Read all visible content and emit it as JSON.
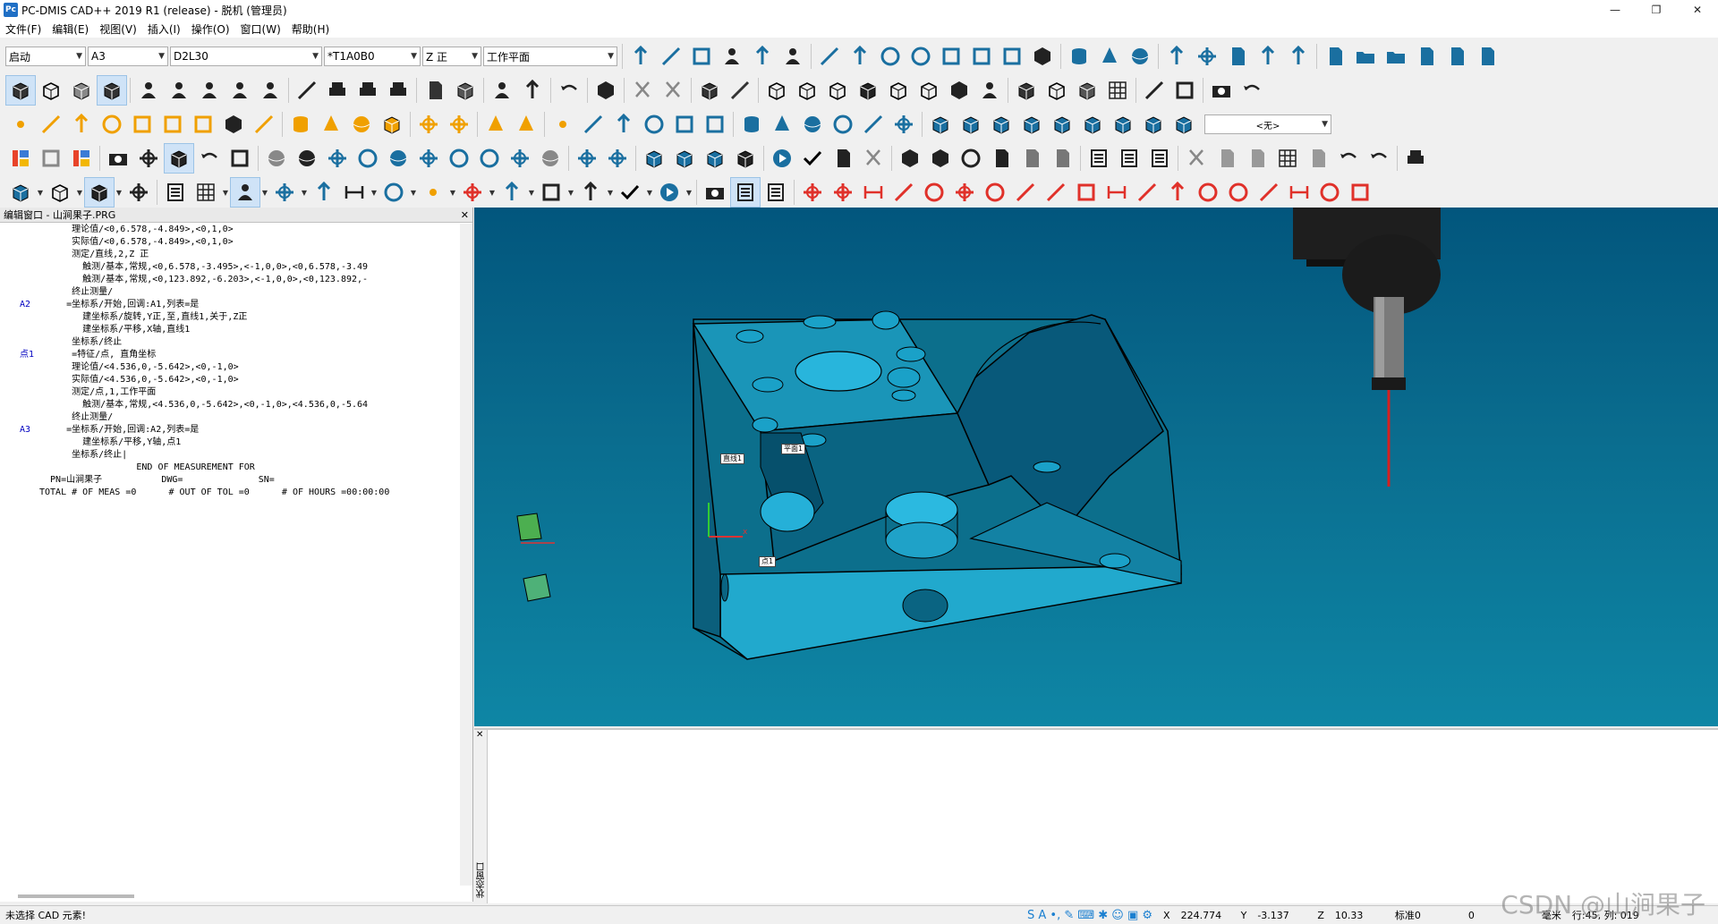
{
  "window": {
    "title": "PC-DMIS CAD++ 2019 R1 (release) - 脱机 (管理员)",
    "icon_text": "Pc",
    "minimize": "—",
    "restore": "❐",
    "close": "✕"
  },
  "menu": [
    "文件(F)",
    "编辑(E)",
    "视图(V)",
    "插入(I)",
    "操作(O)",
    "窗口(W)",
    "帮助(H)"
  ],
  "combos": {
    "mode": "启动",
    "alignment": "A3",
    "probe": "D2L30",
    "tip": "*T1A0B0",
    "direction": "Z 正",
    "workplane": "工作平面",
    "none": "<无>"
  },
  "editor": {
    "title": "编辑窗口 - 山涧果子.PRG",
    "close": "✕",
    "lines": [
      {
        "label": "",
        "text": "      理论值/<0,6.578,-4.849>,<0,1,0>"
      },
      {
        "label": "",
        "text": "      实际值/<0,6.578,-4.849>,<0,1,0>"
      },
      {
        "label": "",
        "text": "      测定/直线,2,Z 正"
      },
      {
        "label": "",
        "text": "        触测/基本,常规,<0,6.578,-3.495>,<-1,0,0>,<0,6.578,-3.49"
      },
      {
        "label": "",
        "text": "        触测/基本,常规,<0,123.892,-6.203>,<-1,0,0>,<0,123.892,-"
      },
      {
        "label": "",
        "text": "      终止测量/"
      },
      {
        "label": "A2",
        "text": "     =坐标系/开始,回调:A1,列表=是"
      },
      {
        "label": "",
        "text": "        建坐标系/旋转,Y正,至,直线1,关于,Z正"
      },
      {
        "label": "",
        "text": "        建坐标系/平移,X轴,直线1"
      },
      {
        "label": "",
        "text": "      坐标系/终止"
      },
      {
        "label": "点1",
        "text": "      =特征/点, 直角坐标"
      },
      {
        "label": "",
        "text": "      理论值/<4.536,0,-5.642>,<0,-1,0>"
      },
      {
        "label": "",
        "text": "      实际值/<4.536,0,-5.642>,<0,-1,0>"
      },
      {
        "label": "",
        "text": "      测定/点,1,工作平面"
      },
      {
        "label": "",
        "text": "        触测/基本,常规,<4.536,0,-5.642>,<0,-1,0>,<4.536,0,-5.64"
      },
      {
        "label": "",
        "text": "      终止测量/"
      },
      {
        "label": "A3",
        "text": "     =坐标系/开始,回调:A2,列表=是"
      },
      {
        "label": "",
        "text": "        建坐标系/平移,Y轴,点1"
      },
      {
        "label": "",
        "text": "      坐标系/终止|"
      },
      {
        "label": "",
        "text": "                  END OF MEASUREMENT FOR"
      },
      {
        "label": "",
        "text": "  PN=山涧果子           DWG=              SN="
      },
      {
        "label": "",
        "text": "TOTAL # OF MEAS =0      # OUT OF TOL =0      # OF HOURS =00:00:00"
      }
    ]
  },
  "viewport": {
    "tag_line": "直线1",
    "tag_plane": "平面1",
    "tag_point": "点1",
    "axis_x": "x"
  },
  "status_window": {
    "label": "状态窗口",
    "close": "✕"
  },
  "statusbar": {
    "message": "未选择 CAD 元素!",
    "x_label": "X",
    "x": "224.774",
    "y_label": "Y",
    "y": "-3.137",
    "z_label": "Z",
    "z": "10.33",
    "std_label": "标准0",
    "zero": "0",
    "unit": "毫米",
    "position": "行:45, 列: 019"
  },
  "watermark": "CSDN @山涧果子",
  "colors": {
    "viewport_top": "#02567d",
    "viewport_bottom": "#0e86a5",
    "part": "#1a95b8",
    "toolbar_icon": "#1a6fa0",
    "measure_icon": "#e0312a"
  }
}
